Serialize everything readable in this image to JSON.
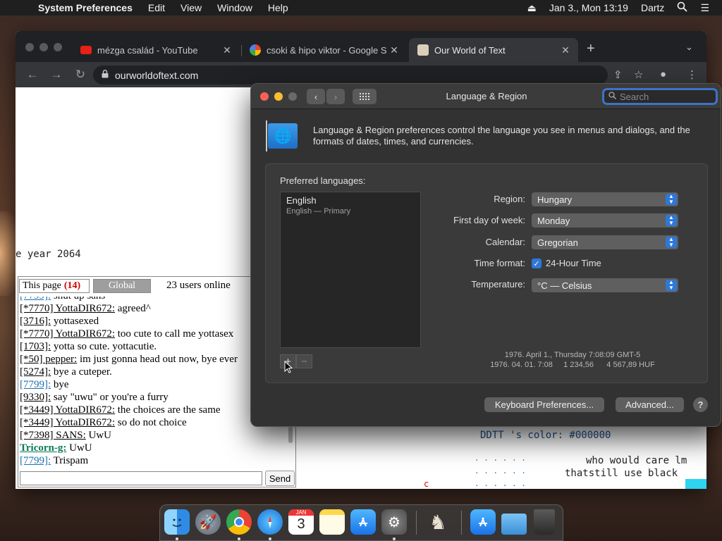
{
  "menubar": {
    "app": "System Preferences",
    "items": [
      "Edit",
      "View",
      "Window",
      "Help"
    ],
    "date": "Jan 3., Mon",
    "time": "13:19",
    "user": "Dartz"
  },
  "browser": {
    "tabs": [
      {
        "label": "mézga család - YouTube",
        "icon": "youtube-icon"
      },
      {
        "label": "csoki & hipo viktor - Google Se",
        "icon": "google-icon"
      },
      {
        "label": "Our World of Text",
        "icon": "owot-icon"
      }
    ],
    "url": "ourworldoftext.com"
  },
  "owot": {
    "year_text": "e year 2064",
    "bottom_lines": [
      "DDTT 's color: #000000",
      "who would care lm",
      "thatstill use black"
    ],
    "dots": ". . . . . .",
    "c_char": "c"
  },
  "chat": {
    "tab_this_page": "This page",
    "this_page_count": "(14)",
    "tab_global": "Global",
    "users_online": "23 users online",
    "send_label": "Send",
    "messages": [
      {
        "nick": "[7799]:",
        "text": " shut up sans",
        "style": "blue"
      },
      {
        "nick": "[*7770] YottaDIR672:",
        "text": " agreed^",
        "style": "plain"
      },
      {
        "nick": "[3716]:",
        "text": " yottasexed",
        "style": "plain"
      },
      {
        "nick": "[*7770] YottaDIR672:",
        "text": " too cute to call me yottasex",
        "style": "plain"
      },
      {
        "nick": "[1703]:",
        "text": " yotta so cute. yottacutie.",
        "style": "plain"
      },
      {
        "nick": "[*50] pepper:",
        "text": " im just gonna head out now, bye ever",
        "style": "plain"
      },
      {
        "nick": "[5274]:",
        "text": " bye a cuteper.",
        "style": "plain"
      },
      {
        "nick": "[7799]:",
        "text": " bye",
        "style": "blue"
      },
      {
        "nick": "[9330]:",
        "text": " say \"uwu\" or you're a furry",
        "style": "plain"
      },
      {
        "nick": "[*3449] YottaDIR672:",
        "text": " the choices are the same",
        "style": "plain"
      },
      {
        "nick": "[*3449] YottaDIR672:",
        "text": " so do not choice",
        "style": "plain"
      },
      {
        "nick": "[*7398] SANS:",
        "text": " UwU",
        "style": "plain"
      },
      {
        "nick": "Tricorn-g:",
        "text": " UwU",
        "style": "green"
      },
      {
        "nick": "[7799]:",
        "text": " Trispam",
        "style": "blue"
      }
    ]
  },
  "prefs": {
    "title": "Language & Region",
    "search_placeholder": "Search",
    "intro": "Language & Region preferences control the language you see in menus and dialogs, and the formats of dates, times, and currencies.",
    "preferred_languages_label": "Preferred languages:",
    "language_name": "English",
    "language_sub": "English — Primary",
    "region_label": "Region:",
    "region_value": "Hungary",
    "first_day_label": "First day of week:",
    "first_day_value": "Monday",
    "calendar_label": "Calendar:",
    "calendar_value": "Gregorian",
    "time_format_label": "Time format:",
    "time_format_value": "24-Hour Time",
    "temperature_label": "Temperature:",
    "temperature_value": "°C — Celsius",
    "sample_date": "1976. April 1., Thursday 7:08:09 GMT-5",
    "sample_numbers": "1976. 04. 01. 7:08     1 234,56      4 567,89 HUF",
    "keyboard_button": "Keyboard Preferences...",
    "advanced_button": "Advanced...",
    "help_label": "?"
  },
  "dock": {
    "apps": [
      "finder",
      "launchpad",
      "chrome",
      "safari",
      "calendar",
      "notes",
      "app-store",
      "system-preferences",
      "chess",
      "app-store-2",
      "folder",
      "trash"
    ],
    "calendar_month": "JAN",
    "calendar_day": "3"
  },
  "colors": {
    "accent": "#2e78d8",
    "search_focus": "#3d73c9"
  }
}
